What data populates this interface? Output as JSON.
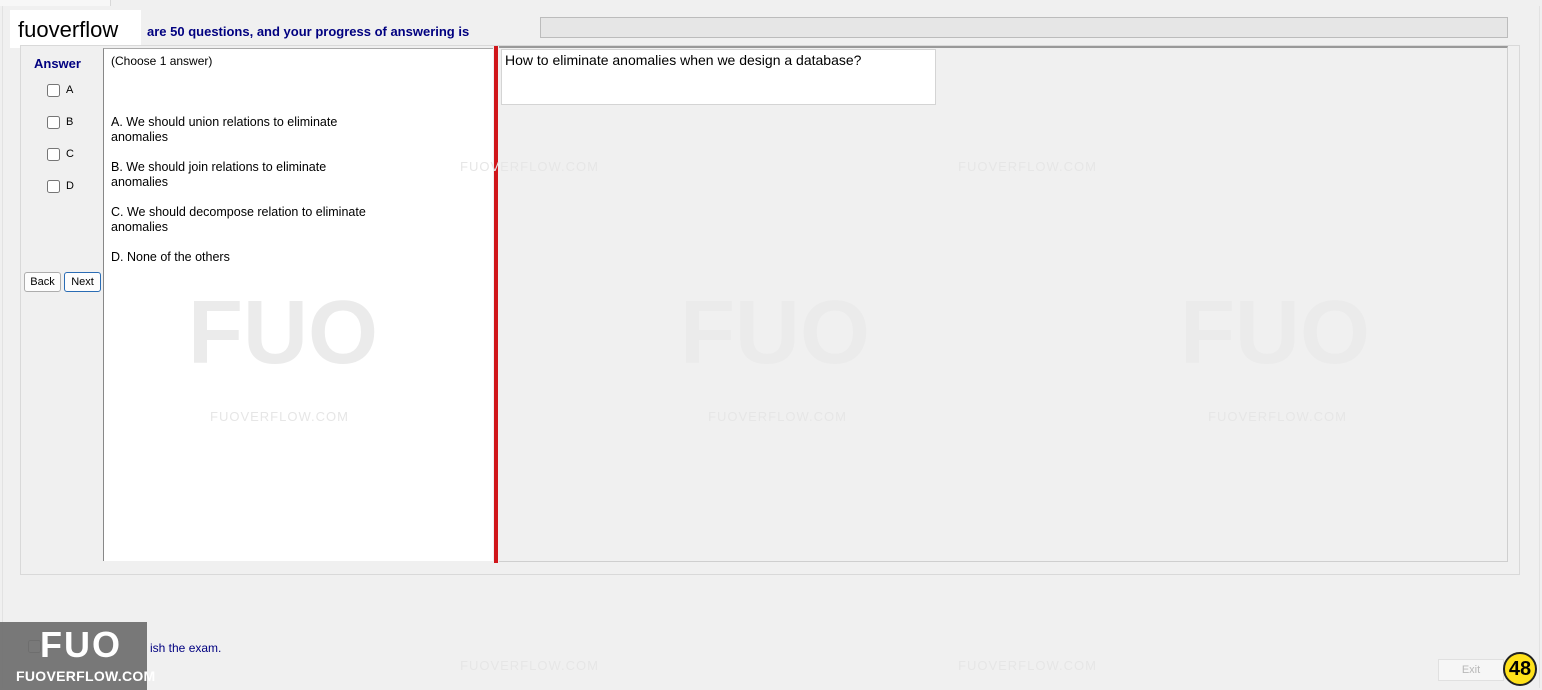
{
  "brand": {
    "name": "fuoverflow"
  },
  "header": {
    "progress_label": "are 50 questions, and your progress of answering is",
    "progress_value": 0
  },
  "answer_panel": {
    "title": "Answer",
    "options": [
      "A",
      "B",
      "C",
      "D"
    ],
    "back_label": "Back",
    "next_label": "Next"
  },
  "choices": {
    "hint": "(Choose 1 answer)",
    "items": [
      "A.  We should union relations to eliminate anomalies",
      "B.  We should join relations  to eliminate anomalies",
      "C.  We should decompose relation to eliminate anomalies",
      "D.  None of the others"
    ]
  },
  "question": {
    "text": "How to eliminate anomalies when we design a database?"
  },
  "watermark": {
    "text": "FUOVERFLOW.COM"
  },
  "footer": {
    "finish_label": "ish the exam.",
    "finish_label_obscured": "I want to finish the exam.",
    "exit_label": "Exit",
    "page_badge": "48"
  },
  "logo": {
    "mark": "FUO",
    "url": "FUOVERFLOW.COM"
  },
  "colors": {
    "accent_blue": "#000080",
    "divider_red": "#d0161b",
    "badge_yellow": "#ffe11a"
  }
}
